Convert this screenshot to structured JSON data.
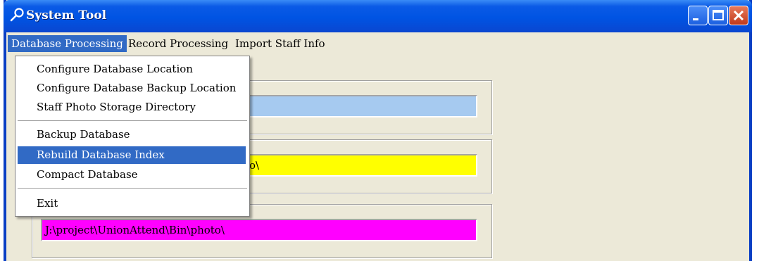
{
  "window": {
    "title": "System Tool",
    "title_icon": "wrench-key-icon",
    "controls": [
      "minimize-icon",
      "maximize-icon",
      "close-icon"
    ]
  },
  "menubar": {
    "items": [
      "Database Processing",
      "Record Processing",
      "Import Staff Info"
    ],
    "active_index": 0
  },
  "dropdown": {
    "items": [
      "Configure Database Location",
      "Configure Database Backup Location",
      "Staff Photo Storage Directory",
      "Backup Database",
      "Rebuild Database Index",
      "Compact Database",
      "Exit"
    ],
    "highlighted_index": 4
  },
  "fields": {
    "db_location": {
      "value": "",
      "color": "#a6caf0"
    },
    "backup_location": {
      "value": "o\\",
      "color": "#ffff00"
    },
    "photo_dir": {
      "value": "J:\\project\\UnionAttend\\Bin\\photo\\",
      "color": "#ff00ff"
    }
  },
  "colors": {
    "titlebar": "#0054e3",
    "highlight": "#316ac5",
    "face": "#ece9d8"
  }
}
